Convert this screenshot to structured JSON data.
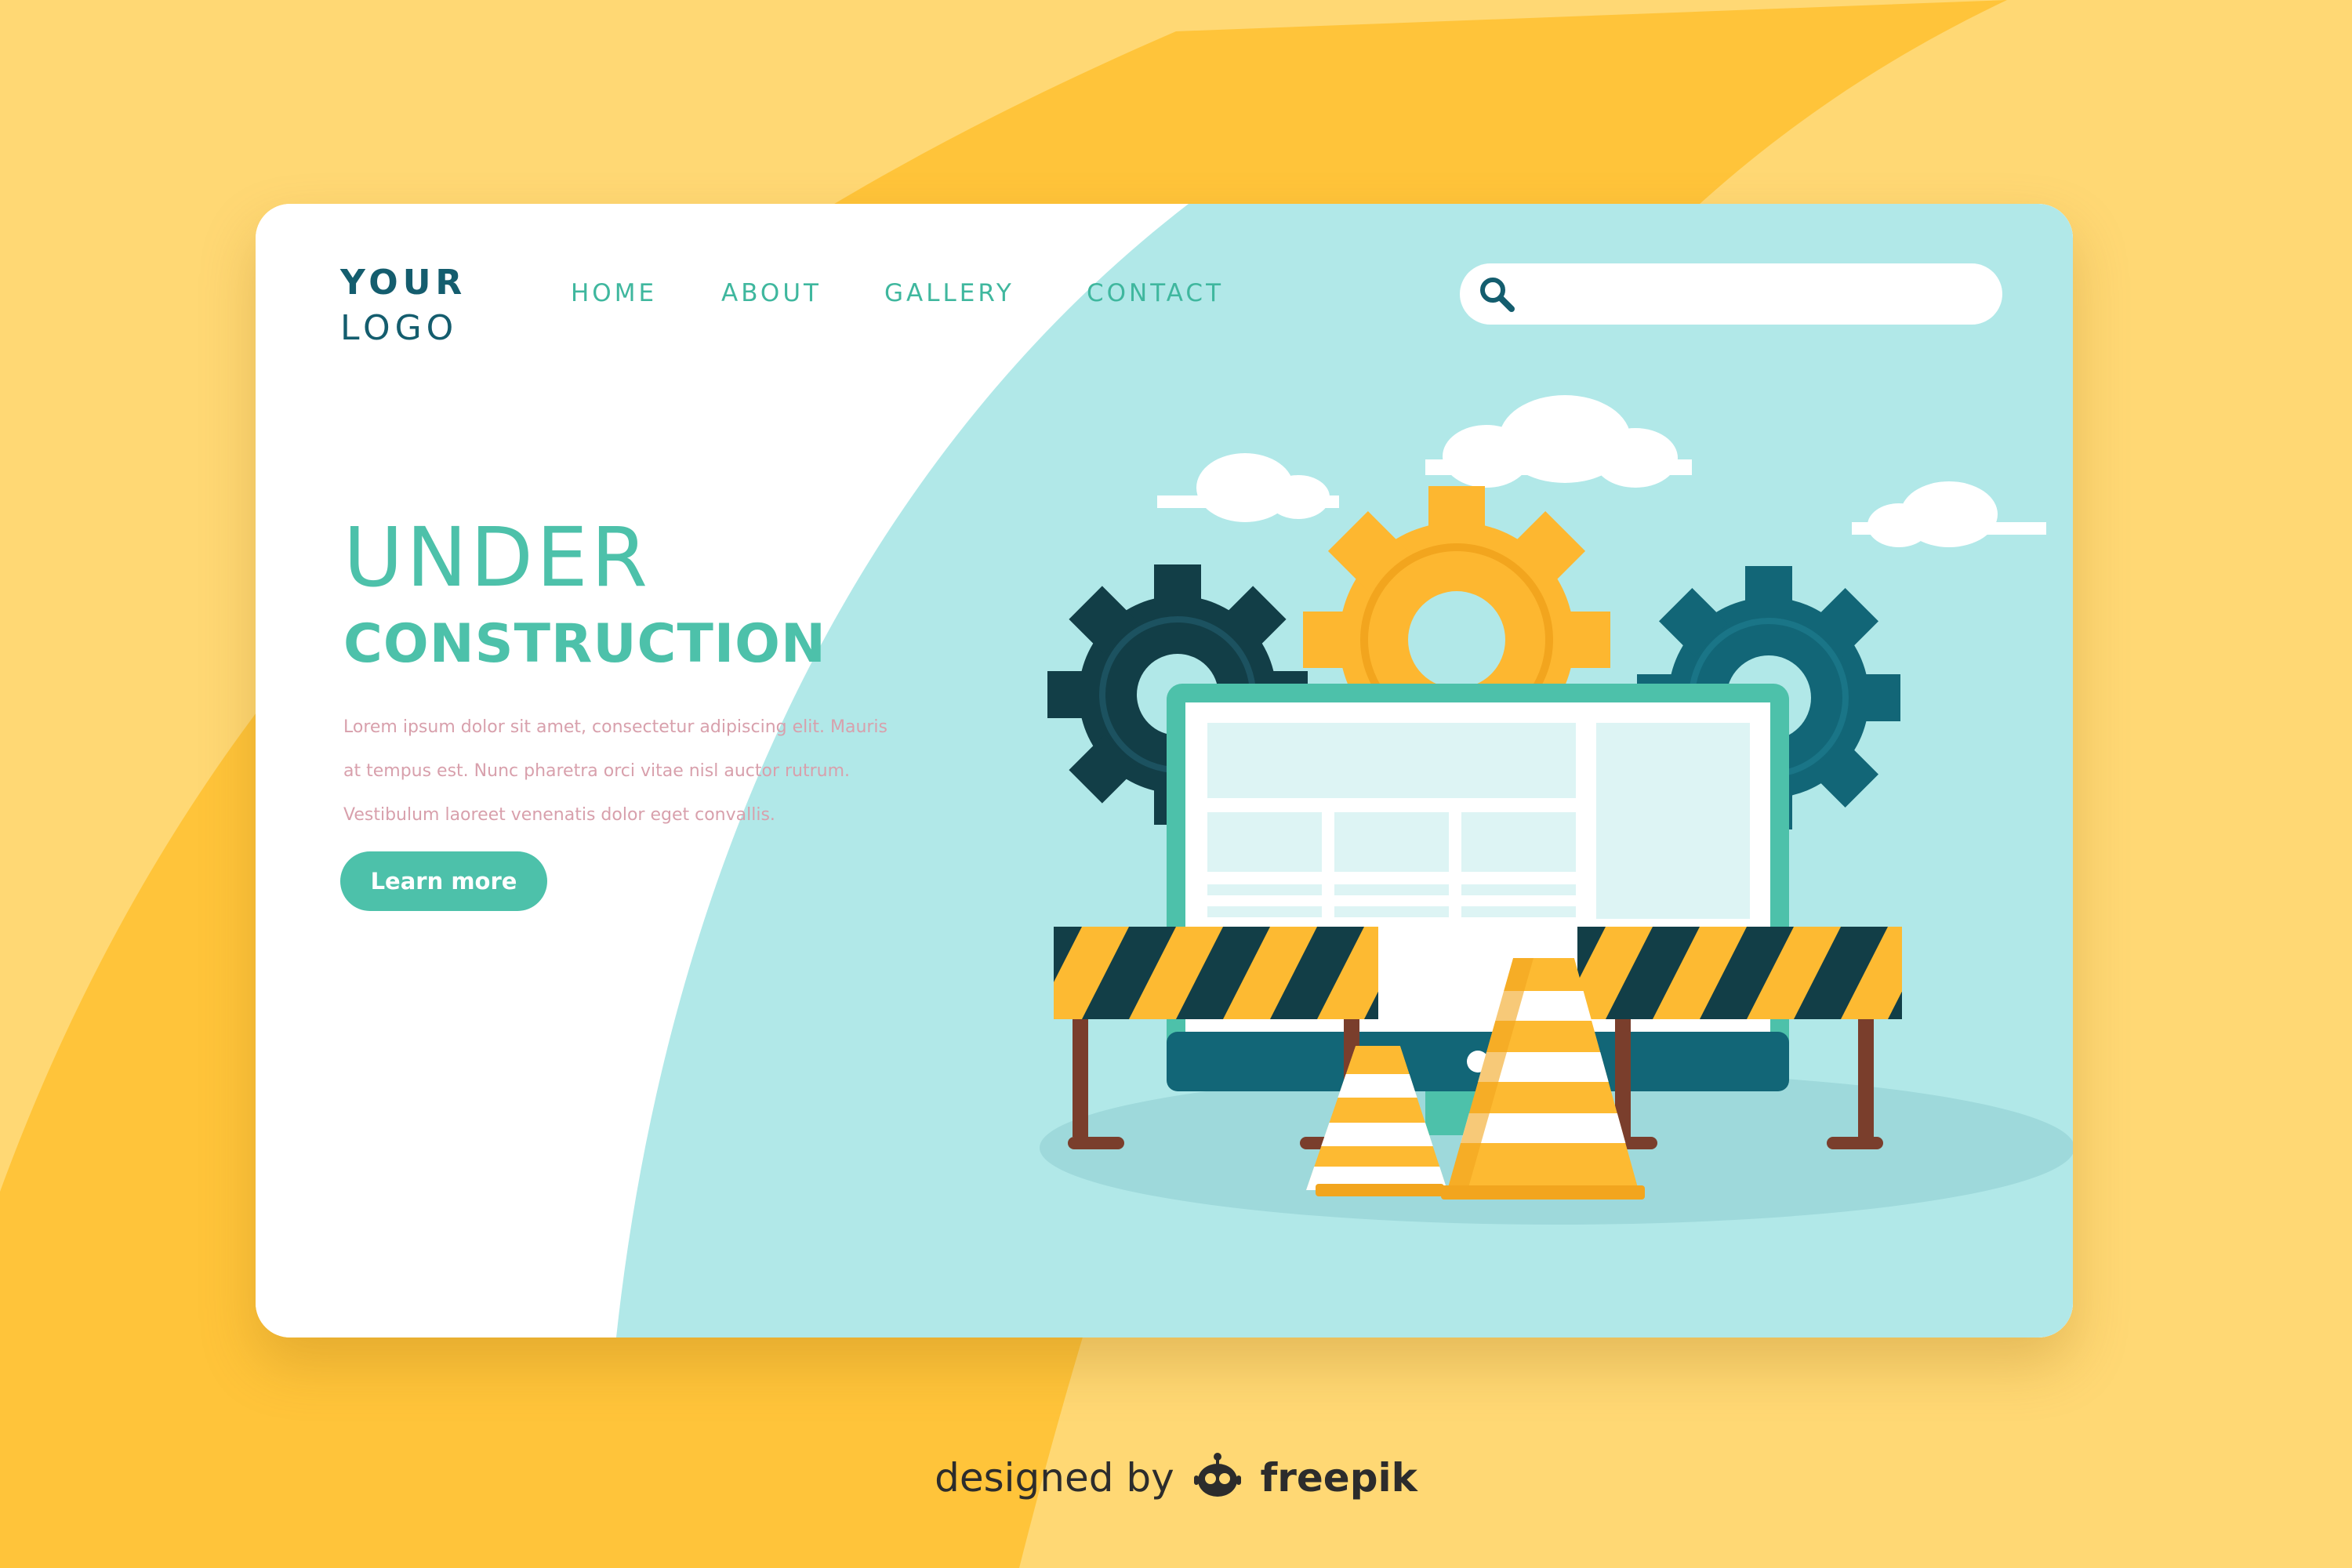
{
  "logo": {
    "line1": "YOUR",
    "line2": "LOGO"
  },
  "nav": {
    "items": [
      {
        "label": "HOME"
      },
      {
        "label": "ABOUT"
      },
      {
        "label": "GALLERY"
      },
      {
        "label": "CONTACT"
      }
    ]
  },
  "search": {
    "icon": "search-icon",
    "placeholder": "",
    "value": ""
  },
  "hero": {
    "title_line1": "UNDER",
    "title_line2": "CONSTRUCTION",
    "description_lines": [
      "Lorem ipsum dolor sit amet, consectetur adipiscing elit. Mauris",
      "at tempus est. Nunc pharetra orci vitae nisl auctor rutrum.",
      "Vestibulum laoreet venenatis dolor eget convallis."
    ],
    "button_label": "Learn more"
  },
  "credit": {
    "prefix": "designed by",
    "brand": "freepik"
  },
  "colors": {
    "page_background": "#FFD874",
    "background_band": "#FFC43A",
    "card": "#FFFFFF",
    "panel": "#B1E8E8",
    "accent": "#4DC1AA",
    "logo_text": "#145D6E",
    "gear_dark": "#123E47",
    "gear_yellow": "#FDB730",
    "gear_teal": "#126677",
    "stripe_yellow": "#FDBA32"
  }
}
